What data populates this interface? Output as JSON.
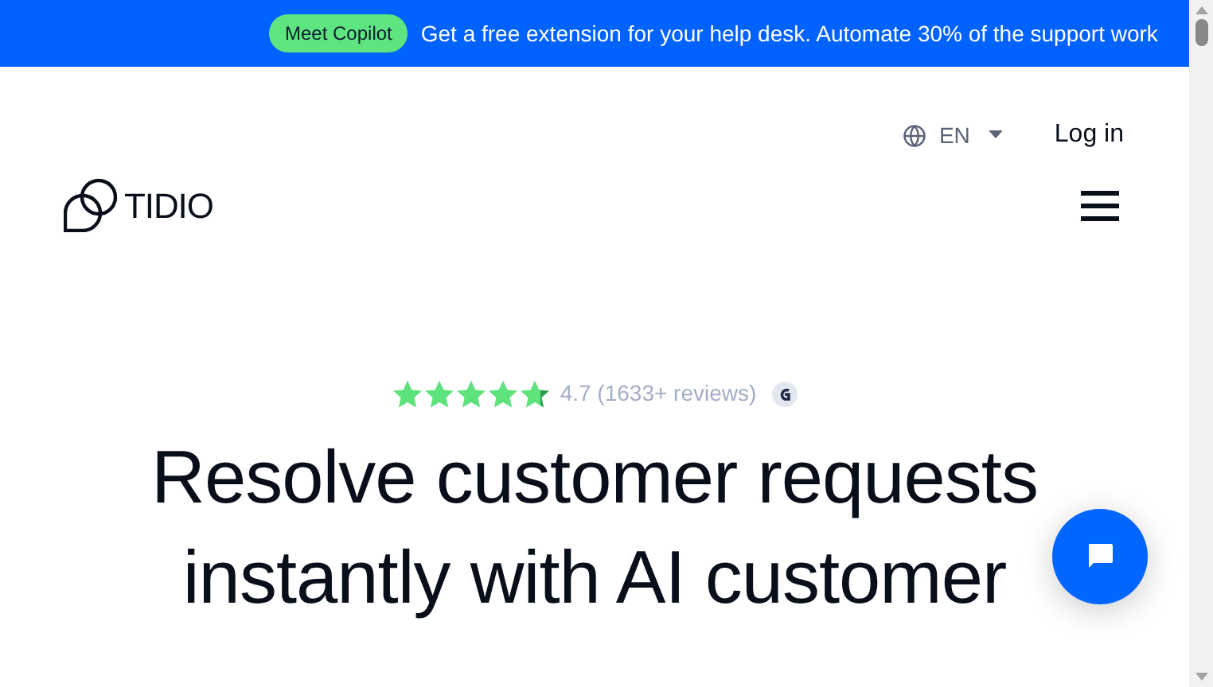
{
  "banner": {
    "badge": "Meet Copilot",
    "text": "Get a free extension for your help desk. Automate 30% of the support work"
  },
  "header": {
    "language": "EN",
    "login": "Log in",
    "logo": "TIDIO"
  },
  "rating": {
    "stars": 4.7,
    "text": "4.7 (1633+ reviews)"
  },
  "hero": {
    "heading": "Resolve customer requests instantly with AI customer"
  }
}
